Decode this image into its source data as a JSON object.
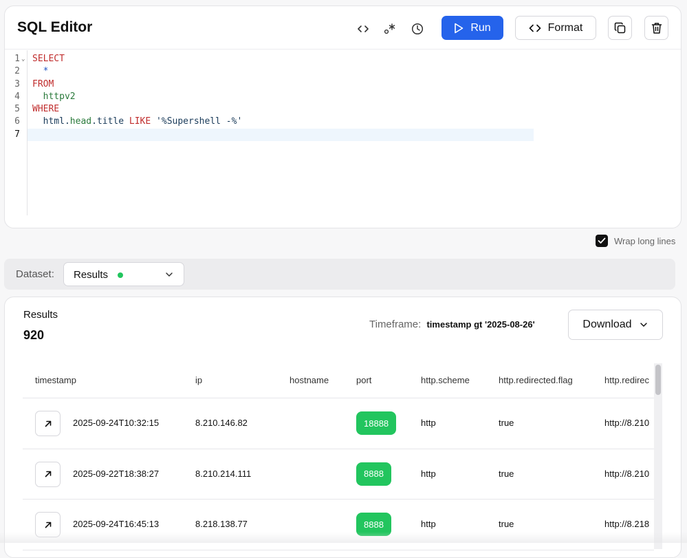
{
  "editor": {
    "title": "SQL Editor",
    "run_label": "Run",
    "format_label": "Format",
    "lines": [
      {
        "num": "1",
        "fold": "⌄",
        "tokens": [
          {
            "t": "SELECT",
            "c": "kw"
          }
        ]
      },
      {
        "num": "2",
        "tokens": [
          {
            "t": "  *",
            "c": "star"
          }
        ]
      },
      {
        "num": "3",
        "tokens": [
          {
            "t": "FROM",
            "c": "kw"
          }
        ]
      },
      {
        "num": "4",
        "tokens": [
          {
            "t": "  httpv2",
            "c": "ident"
          }
        ]
      },
      {
        "num": "5",
        "tokens": [
          {
            "t": "WHERE",
            "c": "kw"
          }
        ]
      },
      {
        "num": "6",
        "tokens": [
          {
            "t": "  html",
            "c": "plain"
          },
          {
            "t": ".",
            "c": "plain"
          },
          {
            "t": "head",
            "c": "ident"
          },
          {
            "t": ".",
            "c": "plain"
          },
          {
            "t": "title",
            "c": "plain"
          },
          {
            "t": " ",
            "c": "plain"
          },
          {
            "t": "LIKE",
            "c": "kw"
          },
          {
            "t": " ",
            "c": "plain"
          },
          {
            "t": "'%Supershell -%'",
            "c": "str"
          }
        ]
      },
      {
        "num": "7",
        "tokens": [],
        "active": true
      }
    ]
  },
  "wrap_long_lines": {
    "label": "Wrap long lines",
    "checked": true
  },
  "dataset": {
    "label": "Dataset:",
    "value": "Results",
    "status_color": "#22c55e"
  },
  "results": {
    "label": "Results",
    "count": "920",
    "timeframe_label": "Timeframe:",
    "timeframe_value": "timestamp gt '2025-08-26'",
    "download_label": "Download",
    "columns": [
      "timestamp",
      "ip",
      "hostname",
      "port",
      "http.scheme",
      "http.redirected.flag",
      "http.redirec"
    ],
    "rows": [
      {
        "timestamp": "2025-09-24T10:32:15",
        "ip": "8.210.146.82",
        "hostname": "",
        "port": "18888",
        "scheme": "http",
        "redirected": "true",
        "redirect": "http://8.210"
      },
      {
        "timestamp": "2025-09-22T18:38:27",
        "ip": "8.210.214.111",
        "hostname": "",
        "port": "8888",
        "scheme": "http",
        "redirected": "true",
        "redirect": "http://8.210"
      },
      {
        "timestamp": "2025-09-24T16:45:13",
        "ip": "8.218.138.77",
        "hostname": "",
        "port": "8888",
        "scheme": "http",
        "redirected": "true",
        "redirect": "http://8.218"
      }
    ]
  },
  "colors": {
    "accent": "#2563eb",
    "success": "#22c55e"
  }
}
